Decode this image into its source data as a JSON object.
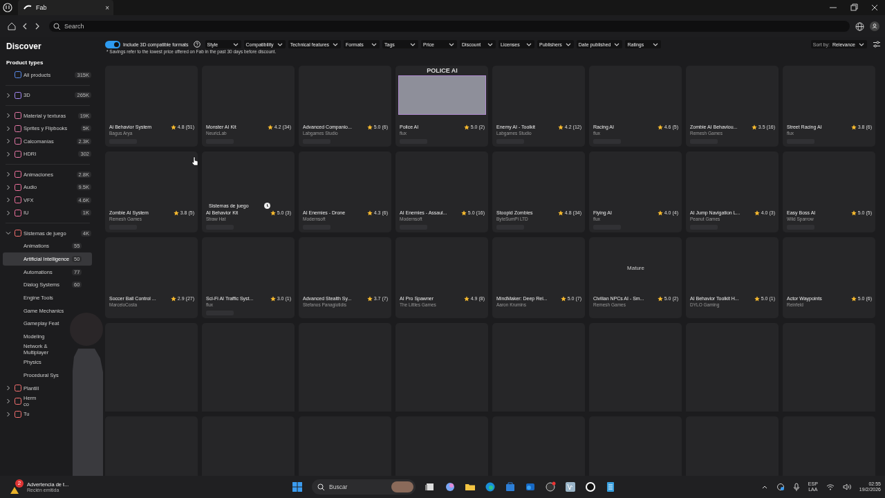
{
  "window": {
    "tab_title": "Fab",
    "tab_close": "×"
  },
  "search": {
    "placeholder": "Search"
  },
  "sidebar": {
    "title": "Discover",
    "section": "Product types",
    "groups": [
      {
        "items": [
          {
            "kind": "root",
            "label": "All products",
            "count": "315K",
            "color": "#5b8def"
          }
        ]
      },
      {
        "items": [
          {
            "kind": "category",
            "label": "3D",
            "count": "265K",
            "color": "#a78bfa",
            "expanded": false
          }
        ]
      },
      {
        "items": [
          {
            "kind": "category",
            "label": "Material y texturas",
            "count": "19K",
            "color": "#e879a8",
            "expanded": false
          },
          {
            "kind": "category",
            "label": "Sprites y Flipbooks",
            "count": "5K",
            "color": "#e879a8",
            "expanded": false
          },
          {
            "kind": "category",
            "label": "Calcomanías",
            "count": "2.3K",
            "color": "#e879a8",
            "expanded": false
          },
          {
            "kind": "category",
            "label": "HDRI",
            "count": "302",
            "color": "#e879a8",
            "expanded": false
          }
        ]
      },
      {
        "items": [
          {
            "kind": "category",
            "label": "Animaciones",
            "count": "2.8K",
            "color": "#f472a0",
            "expanded": false
          },
          {
            "kind": "category",
            "label": "Audio",
            "count": "9.5K",
            "color": "#f472a0",
            "expanded": false
          },
          {
            "kind": "category",
            "label": "VFX",
            "count": "4.6K",
            "color": "#f472a0",
            "expanded": false
          },
          {
            "kind": "category",
            "label": "IU",
            "count": "1K",
            "color": "#f472a0",
            "expanded": false
          }
        ]
      },
      {
        "items": [
          {
            "kind": "category",
            "label": "Sistemas de juego",
            "count": "4K",
            "color": "#f87171",
            "expanded": true,
            "children": [
              {
                "label": "Animations",
                "count": "55",
                "selected": false
              },
              {
                "label": "Artificial Intelligence",
                "count": "50",
                "selected": true
              },
              {
                "label": "Automations",
                "count": "77",
                "selected": false
              },
              {
                "label": "Dialog Systems",
                "count": "60",
                "selected": false
              },
              {
                "label": "Engine Tools",
                "selected": false
              },
              {
                "label": "Game Mechanics",
                "selected": false
              },
              {
                "label": "Gameplay Feat",
                "selected": false
              },
              {
                "label": "Modeling",
                "selected": false
              },
              {
                "label": "Network & Multiplayer",
                "selected": false
              },
              {
                "label": "Physics",
                "selected": false
              },
              {
                "label": "Procedural Sys",
                "selected": false
              }
            ]
          },
          {
            "kind": "category",
            "label": "Plantill",
            "color": "#f87171",
            "expanded": false
          },
          {
            "kind": "category",
            "label": "Herm\nco",
            "color": "#f87171",
            "expanded": false
          },
          {
            "kind": "category",
            "label": "Tu",
            "color": "#f87171",
            "expanded": false
          }
        ]
      }
    ]
  },
  "filters": {
    "toggle": {
      "label": "Include 3D compatible formats",
      "on": true
    },
    "dropdowns": [
      "Style",
      "Compatibility",
      "Technical features",
      "Formats",
      "Tags",
      "Price",
      "Discount",
      "Licenses",
      "Publishers",
      "Date published",
      "Ratings"
    ],
    "note": "* Savings refer to the lowest price offered on Fab in the past 30 days before discount.",
    "sort": {
      "label": "Sort by:",
      "value": "Relevance"
    }
  },
  "cards": [
    {
      "kind": "product",
      "title": "Ai Behavior System",
      "rating": "4.8",
      "reviews": "(51)",
      "publisher": "Bagus Arya",
      "price_loading": true
    },
    {
      "kind": "product",
      "title": "Monster AI Kit",
      "rating": "4.2",
      "reviews": "(34)",
      "publisher": "NeuricLab",
      "price_loading": true
    },
    {
      "kind": "product",
      "title": "Advanced Companio...",
      "rating": "5.0",
      "reviews": "(6)",
      "publisher": "Labgames Studio",
      "price_loading": true
    },
    {
      "kind": "product",
      "title": "Police AI",
      "rating": "5.0",
      "reviews": "(2)",
      "publisher": "flux",
      "price_loading": true,
      "image_caption": "POLICE AI"
    },
    {
      "kind": "product",
      "title": "Enemy AI - Toolkit",
      "rating": "4.2",
      "reviews": "(12)",
      "publisher": "Labgames Studio",
      "price_loading": true
    },
    {
      "kind": "product",
      "title": "Racing AI",
      "rating": "4.6",
      "reviews": "(5)",
      "publisher": "flux",
      "price_loading": true
    },
    {
      "kind": "product",
      "title": "Zombie AI Behaviou...",
      "rating": "3.5",
      "reviews": "(16)",
      "publisher": "Remesh Games",
      "price_loading": true
    },
    {
      "kind": "product",
      "title": "Street Racing AI",
      "rating": "3.8",
      "reviews": "(6)",
      "publisher": "flux",
      "price_loading": true
    },
    {
      "kind": "product",
      "title": "Zombie AI System",
      "rating": "3.8",
      "reviews": "(5)",
      "publisher": "Remesh Games",
      "price_loading": true
    },
    {
      "kind": "product",
      "title": "AI Behavior Kit",
      "rating": "5.0",
      "reviews": "(3)",
      "publisher": "Straw Hat",
      "price_loading": true,
      "hover_tag": "Sistemas de juego"
    },
    {
      "kind": "product",
      "title": "AI Enemies - Drone",
      "rating": "4.3",
      "reviews": "(6)",
      "publisher": "Modernsoft",
      "price_loading": true
    },
    {
      "kind": "product",
      "title": "AI Enemies - Assaul...",
      "rating": "5.0",
      "reviews": "(16)",
      "publisher": "Modernsoft",
      "price_loading": true
    },
    {
      "kind": "product",
      "title": "Stoopid Zombies",
      "rating": "4.8",
      "reviews": "(34)",
      "publisher": "ByteSumPi LTD",
      "price_loading": true
    },
    {
      "kind": "product",
      "title": "Flying AI",
      "rating": "4.0",
      "reviews": "(4)",
      "publisher": "flux",
      "price_loading": true
    },
    {
      "kind": "product",
      "title": "AI Jump Navigation L...",
      "rating": "4.0",
      "reviews": "(3)",
      "publisher": "Peanut Games",
      "price_loading": true
    },
    {
      "kind": "product",
      "title": "Easy Boss AI",
      "rating": "5.0",
      "reviews": "(5)",
      "publisher": "Wild Sparrow",
      "price_loading": true
    },
    {
      "kind": "product",
      "title": "Soccer Ball Control ...",
      "rating": "2.9",
      "reviews": "(27)",
      "publisher": "MarceloCosta",
      "price_loading": false
    },
    {
      "kind": "product",
      "title": "Sci-Fi AI Traffic Syst...",
      "rating": "3.0",
      "reviews": "(1)",
      "publisher": "flux",
      "price_loading": true
    },
    {
      "kind": "product",
      "title": "Advanced Stealth Sy...",
      "rating": "3.7",
      "reviews": "(7)",
      "publisher": "Stefanos Panagiotidis",
      "price_loading": false
    },
    {
      "kind": "product",
      "title": "AI Pro Spawner",
      "rating": "4.9",
      "reviews": "(8)",
      "publisher": "The Littles Games",
      "price_loading": false
    },
    {
      "kind": "product",
      "title": "MindMaker: Deep Rei...",
      "rating": "5.0",
      "reviews": "(7)",
      "publisher": "Aaron Krumins",
      "price_loading": false
    },
    {
      "kind": "product",
      "title": "Civilian NPCs AI - Sm...",
      "rating": "5.0",
      "reviews": "(2)",
      "publisher": "Remesh Games",
      "price_loading": false,
      "image_caption": "Mature"
    },
    {
      "kind": "product",
      "title": "AI Behavior Toolkit H...",
      "rating": "5.0",
      "reviews": "(1)",
      "publisher": "DYLO Gaming",
      "price_loading": false
    },
    {
      "kind": "product",
      "title": "Actor Waypoints",
      "rating": "5.0",
      "reviews": "(6)",
      "publisher": "Reinfeld",
      "price_loading": false
    },
    {
      "kind": "skeleton"
    },
    {
      "kind": "skeleton"
    },
    {
      "kind": "skeleton"
    },
    {
      "kind": "skeleton"
    },
    {
      "kind": "skeleton"
    },
    {
      "kind": "skeleton"
    },
    {
      "kind": "skeleton"
    },
    {
      "kind": "skeleton"
    },
    {
      "kind": "skeleton"
    },
    {
      "kind": "skeleton"
    },
    {
      "kind": "skeleton"
    },
    {
      "kind": "skeleton"
    },
    {
      "kind": "skeleton"
    },
    {
      "kind": "skeleton"
    },
    {
      "kind": "skeleton"
    },
    {
      "kind": "skeleton"
    }
  ],
  "taskbar": {
    "notification": {
      "badge": "2",
      "title": "Advertencia de t...",
      "subtitle": "Recién emitida"
    },
    "search_placeholder": "Buscar",
    "language": "ESP",
    "layout": "LAA",
    "time": "02:55",
    "date": "19/2/2026"
  }
}
